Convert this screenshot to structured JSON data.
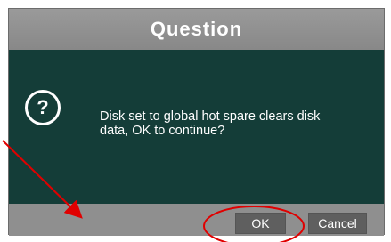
{
  "dialog": {
    "title": "Question",
    "icon": "question-circle-icon",
    "message": "Disk set to global hot spare clears disk\n data, OK to continue?",
    "buttons": {
      "ok_label": "OK",
      "cancel_label": "Cancel"
    }
  },
  "colors": {
    "body_panel": "#143d38",
    "frame_gray": "#8f8f8f",
    "button_gray": "#5f5f5f",
    "annotation_red": "#e00000"
  }
}
